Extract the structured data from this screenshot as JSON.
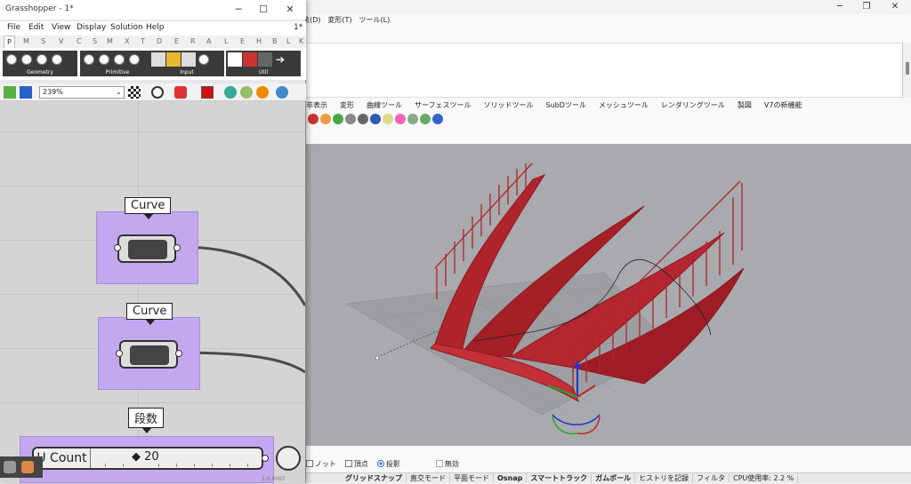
{
  "rhino": {
    "menu": [
      "法(D)",
      "変形(T)",
      "ツール(L)"
    ],
    "tabs": [
      "非表示",
      "変形",
      "曲線ツール",
      "サーフェスツール",
      "ソリッドツール",
      "SubDツール",
      "メッシュツール",
      "レンダリングツール",
      "製図",
      "V7の新機能"
    ],
    "osnap": {
      "knot": "ノット",
      "vertex": "頂点",
      "project": "投影",
      "disable": "無効"
    },
    "status": [
      "グリッドスナップ",
      "直交モード",
      "平面モード",
      "Osnap",
      "スマートトラック",
      "ガムボール",
      "ヒストリを記録",
      "フィルタ",
      "CPU使用率: 2.2 %"
    ],
    "viewport_colors": {
      "bg": "#a8aaad",
      "geometry": "#b0242c"
    }
  },
  "gh": {
    "title": "Grasshopper - 1*",
    "menu": [
      "File",
      "Edit",
      "View",
      "Display",
      "Solution",
      "Help"
    ],
    "menu_right": "1*",
    "tabs": [
      "P",
      "M",
      "S",
      "V",
      "C",
      "S",
      "M",
      "X",
      "T",
      "D",
      "E",
      "R",
      "A",
      "L",
      "E",
      "H",
      "B",
      "L",
      "K"
    ],
    "groups": [
      "Geometry",
      "Primitive",
      "Input",
      "Util"
    ],
    "zoom": "239%",
    "components": [
      {
        "label": "Curve"
      },
      {
        "label": "Curve"
      }
    ],
    "slider_group_label": "段数",
    "slider": {
      "name": "U Count",
      "value": "◆ 20"
    },
    "version": "1.0.0007"
  }
}
